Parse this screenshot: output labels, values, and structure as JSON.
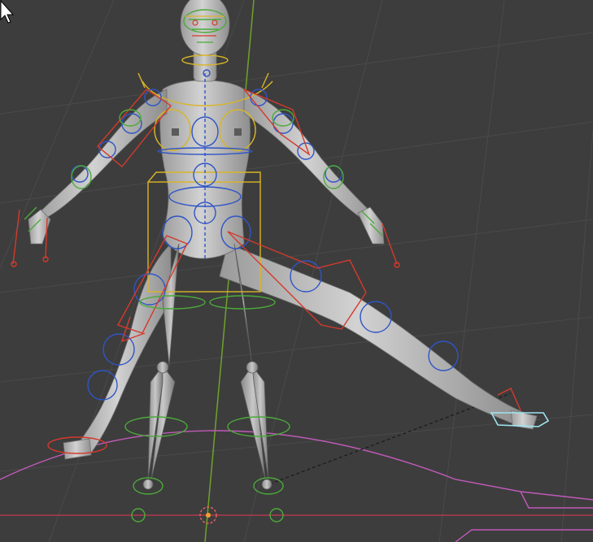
{
  "viewport": {
    "mode": "3d-pose-mode",
    "background": "#3d3d3d",
    "grid_color": "#4a4a4a",
    "z_axis_color": "#6fa22b",
    "x_axis_color": "#b03a4f",
    "mesh_color": "#bdbdbd",
    "rig_colors": {
      "ik_control": "#d43a2c",
      "fk_control": "#2f55c6",
      "root_control": "#d9b526",
      "secondary": "#4caa3a",
      "selected": "#9fe4f0",
      "pole_line": "#1a1a1a",
      "floor_circle": "#c05ab8"
    },
    "icons": {
      "cursor": "arrow-pointer-icon",
      "origin": "3d-cursor-icon"
    }
  }
}
